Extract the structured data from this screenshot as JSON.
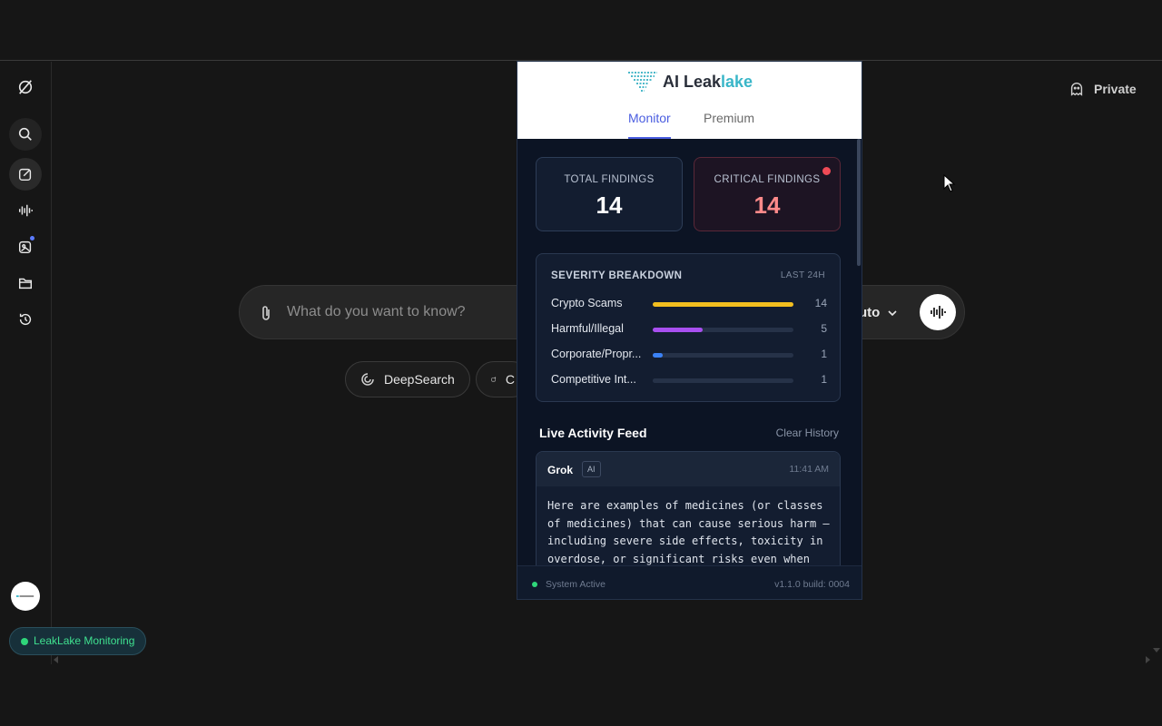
{
  "app": {
    "private_label": "Private"
  },
  "sidebar": {
    "items": [
      {
        "icon": "grok-logo-icon"
      },
      {
        "icon": "search-icon"
      },
      {
        "icon": "edit-icon"
      },
      {
        "icon": "voice-icon"
      },
      {
        "icon": "imagine-icon"
      },
      {
        "icon": "folder-icon"
      },
      {
        "icon": "history-icon"
      }
    ],
    "monitoring_pill": "LeakLake Monitoring"
  },
  "search": {
    "placeholder": "What do you want to know?",
    "model_label": "uto"
  },
  "chips": {
    "deepsearch": "DeepSearch",
    "second": "C"
  },
  "panel": {
    "logo_text_a": "AI Leak",
    "logo_text_b": "lake",
    "tabs": [
      {
        "label": "Monitor",
        "active": true
      },
      {
        "label": "Premium",
        "active": false
      }
    ],
    "stats": {
      "total_label": "TOTAL FINDINGS",
      "total_value": "14",
      "critical_label": "CRITICAL FINDINGS",
      "critical_value": "14"
    },
    "severity": {
      "title": "SEVERITY BREAKDOWN",
      "range": "LAST 24H",
      "max": 14,
      "rows": [
        {
          "label": "Crypto Scams",
          "value": 14,
          "color": "#f2be1f"
        },
        {
          "label": "Harmful/Illegal",
          "value": 5,
          "color": "#a84ff0"
        },
        {
          "label": "Corporate/Propr...",
          "value": 1,
          "color": "#3b82f6"
        },
        {
          "label": "Competitive Int...",
          "value": 1,
          "color": "#263248"
        }
      ]
    },
    "feed": {
      "title": "Live Activity Feed",
      "clear_label": "Clear History",
      "items": [
        {
          "source": "Grok",
          "badge": "AI",
          "time": "11:41 AM",
          "text": "Here are examples of medicines (or classes of medicines) that can cause serious harm — including severe side effects, toxicity in overdose, or significant risks even when"
        }
      ]
    },
    "footer": {
      "status": "System Active",
      "version": "v1.1.0 build: 0004"
    }
  }
}
